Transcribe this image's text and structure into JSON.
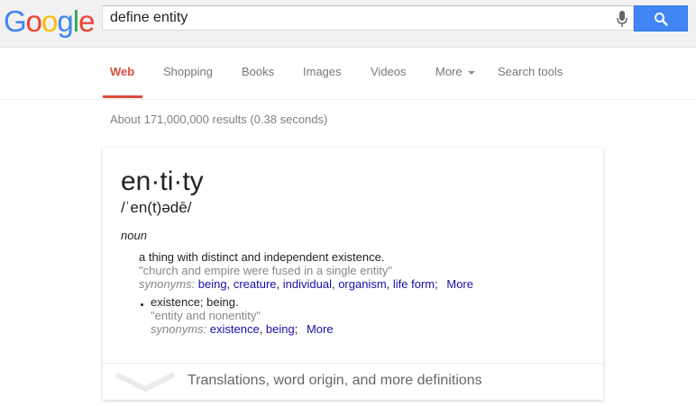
{
  "header": {
    "logo_letters": [
      {
        "ch": "G",
        "color": "#4285f4"
      },
      {
        "ch": "o",
        "color": "#ea4335"
      },
      {
        "ch": "o",
        "color": "#fbbc05"
      },
      {
        "ch": "g",
        "color": "#4285f4"
      },
      {
        "ch": "l",
        "color": "#34a853"
      },
      {
        "ch": "e",
        "color": "#ea4335"
      }
    ],
    "search_value": "define entity",
    "mic_icon": "microphone-icon",
    "search_icon": "search-icon",
    "button_color": "#4285f4"
  },
  "tabs": {
    "web": "Web",
    "shopping": "Shopping",
    "books": "Books",
    "images": "Images",
    "videos": "Videos",
    "more": "More",
    "tools": "Search tools",
    "active_color": "#dd4b39"
  },
  "stats": "About 171,000,000 results (0.38 seconds)",
  "card": {
    "word": "en·ti·ty",
    "phonetic": "/ˈen(t)ədē/",
    "part_of_speech": "noun",
    "senses": [
      {
        "definition": "a thing with distinct and independent existence.",
        "example": "\"church and empire were fused in a single entity\"",
        "synonyms_label": "synonyms:",
        "synonyms": [
          "being",
          "creature",
          "individual",
          "organism",
          "life form"
        ],
        "more": "More"
      },
      {
        "definition": "existence; being.",
        "example": "\"entity and nonentity\"",
        "synonyms_label": "synonyms:",
        "synonyms": [
          "existence",
          "being"
        ],
        "more": "More"
      }
    ],
    "footer_text": "Translations, word origin, and more definitions"
  }
}
